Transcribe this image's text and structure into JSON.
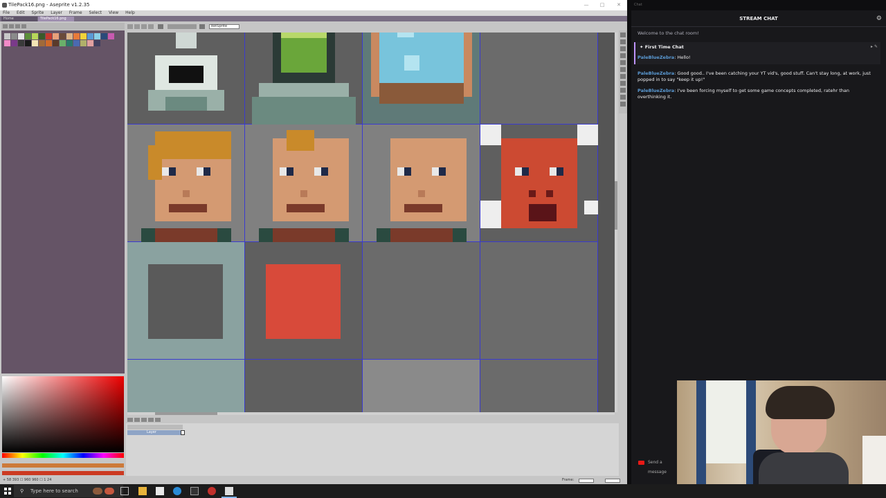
{
  "aseprite": {
    "window_title": "TilePack16.png - Aseprite v1.2.35",
    "menu": [
      "File",
      "Edit",
      "Sprite",
      "Layer",
      "Frame",
      "Select",
      "View",
      "Help"
    ],
    "tabs": [
      "Home",
      "TilePack16.png"
    ],
    "sprite_dropdown": "RotSprite",
    "timeline_layer": "Layer",
    "frame_label": "Frame:",
    "status_left": "+ 58 393  ☐ 960 960  ☐ 1 24",
    "colors": {
      "fg": "#cc7a3a",
      "bg": "#cc3a22"
    }
  },
  "chat": {
    "top_label": "Chat",
    "header": "STREAM CHAT",
    "welcome": "Welcome to the chat room!",
    "first_time_label": "First Time Chat",
    "messages": [
      {
        "user": "PaleBlueZebra",
        "text": ": Hello!"
      },
      {
        "user": "PaleBlueZebra",
        "text": ": Good good.. I've been catching your YT vid's, good stuff. Can't stay long, at work, just popped in to say \"keep it up!\""
      },
      {
        "user": "PaleBlueZebra",
        "text": ": I've been forcing myself to get some game concepts completed, ratehr than overthinking it."
      }
    ],
    "send_placeholder": "Send a message"
  },
  "taskbar": {
    "search_placeholder": "Type here to search"
  }
}
